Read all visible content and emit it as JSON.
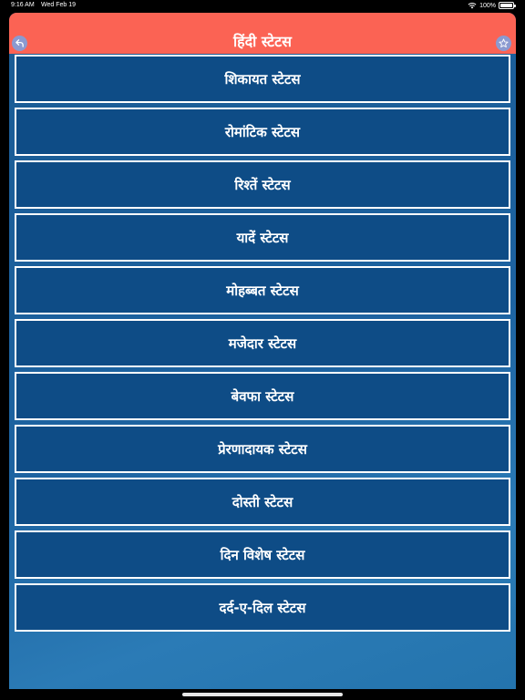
{
  "status_bar": {
    "time": "9:16 AM",
    "date": "Wed Feb 19",
    "battery": "100%",
    "icons": [
      "wifi-icon",
      "battery-icon"
    ]
  },
  "header": {
    "title": "हिंदी स्टेटस",
    "back_icon": "back-arrow-icon",
    "favorite_icon": "star-icon",
    "color": "#fb6354"
  },
  "categories": [
    {
      "label": "शिकायत स्टेटस"
    },
    {
      "label": "रोमांटिक स्टेटस"
    },
    {
      "label": "रिश्तें स्टेटस"
    },
    {
      "label": "यादें स्टेटस"
    },
    {
      "label": "मोहब्बत स्टेटस"
    },
    {
      "label": "मजेदार स्टेटस"
    },
    {
      "label": "बेवफा स्टेटस"
    },
    {
      "label": "प्रेरणादायक स्टेटस"
    },
    {
      "label": "दोस्ती स्टेटस"
    },
    {
      "label": "दिन विशेष स्टेटस"
    },
    {
      "label": "दर्द-ए-दिल स्टेटस"
    }
  ],
  "colors": {
    "item_background": "#0e4c86",
    "item_border": "#ffffff",
    "app_background": "#1d63a1"
  }
}
